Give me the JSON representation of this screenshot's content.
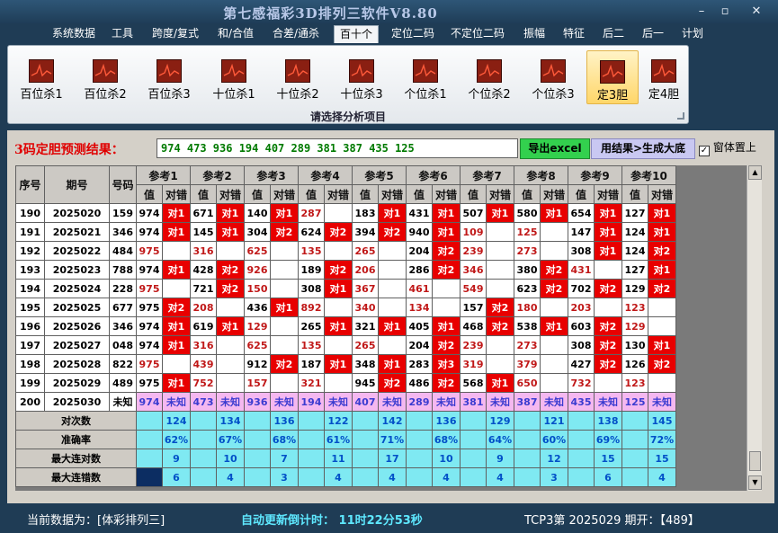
{
  "app": {
    "title": "第七感福彩3D排列三软件V8.80"
  },
  "window_controls": {
    "minimize": "–",
    "maximize": "▫",
    "close": "✕"
  },
  "menu": [
    {
      "label": "系统数据"
    },
    {
      "label": "工具"
    },
    {
      "label": "跨度/复式"
    },
    {
      "label": "和/合值"
    },
    {
      "label": "合差/通杀"
    },
    {
      "label": "百十个",
      "active": true
    },
    {
      "label": "定位二码"
    },
    {
      "label": "不定位二码"
    },
    {
      "label": "振幅"
    },
    {
      "label": "特征"
    },
    {
      "label": "后二"
    },
    {
      "label": "后一"
    },
    {
      "label": "计划"
    }
  ],
  "ribbon": {
    "buttons": [
      {
        "label": "百位杀1"
      },
      {
        "label": "百位杀2"
      },
      {
        "label": "百位杀3"
      },
      {
        "label": "十位杀1"
      },
      {
        "label": "十位杀2"
      },
      {
        "label": "十位杀3"
      },
      {
        "label": "个位杀1"
      },
      {
        "label": "个位杀2"
      },
      {
        "label": "个位杀3"
      },
      {
        "label": "定3胆",
        "active": true
      },
      {
        "label": "定4胆"
      }
    ],
    "caption": "请选择分析项目"
  },
  "prediction": {
    "label": "3码定胆预测结果：",
    "value": "974 473 936 194 407 289 381 387 435 125"
  },
  "buttons": {
    "export": "导出excel",
    "generate": "用结果>生成大底"
  },
  "ontop": {
    "label": "窗体置上",
    "checked": "✓"
  },
  "table": {
    "headers": {
      "seq": "序号",
      "period": "期号",
      "number": "号码",
      "refs": [
        "参考1",
        "参考2",
        "参考3",
        "参考4",
        "参考5",
        "参考6",
        "参考7",
        "参考8",
        "参考9",
        "参考10"
      ],
      "value": "值",
      "result": "对错"
    },
    "rows": [
      {
        "seq": "190",
        "period": "2025020",
        "num": "159",
        "cells": [
          [
            "974",
            "对1",
            1
          ],
          [
            "671",
            "对1",
            1
          ],
          [
            "140",
            "对1",
            1
          ],
          [
            "287",
            "",
            0
          ],
          [
            "183",
            "对1",
            1
          ],
          [
            "431",
            "对1",
            1
          ],
          [
            "507",
            "对1",
            1
          ],
          [
            "580",
            "对1",
            1
          ],
          [
            "654",
            "对1",
            1
          ],
          [
            "127",
            "对1",
            1
          ]
        ]
      },
      {
        "seq": "191",
        "period": "2025021",
        "num": "346",
        "cells": [
          [
            "974",
            "对1",
            1
          ],
          [
            "145",
            "对1",
            1
          ],
          [
            "304",
            "对2",
            1
          ],
          [
            "624",
            "对2",
            1
          ],
          [
            "394",
            "对2",
            1
          ],
          [
            "940",
            "对1",
            1
          ],
          [
            "109",
            "",
            0
          ],
          [
            "125",
            "",
            0
          ],
          [
            "147",
            "对1",
            1
          ],
          [
            "124",
            "对1",
            1
          ]
        ]
      },
      {
        "seq": "192",
        "period": "2025022",
        "num": "484",
        "cells": [
          [
            "975",
            "",
            0
          ],
          [
            "316",
            "",
            0
          ],
          [
            "625",
            "",
            0
          ],
          [
            "135",
            "",
            0
          ],
          [
            "265",
            "",
            0
          ],
          [
            "204",
            "对2",
            1
          ],
          [
            "239",
            "",
            0
          ],
          [
            "273",
            "",
            0
          ],
          [
            "308",
            "对1",
            1
          ],
          [
            "124",
            "对2",
            1
          ]
        ]
      },
      {
        "seq": "193",
        "period": "2025023",
        "num": "788",
        "cells": [
          [
            "974",
            "对1",
            1
          ],
          [
            "428",
            "对2",
            1
          ],
          [
            "926",
            "",
            0
          ],
          [
            "189",
            "对2",
            1
          ],
          [
            "206",
            "",
            0
          ],
          [
            "286",
            "对2",
            1
          ],
          [
            "346",
            "",
            0
          ],
          [
            "380",
            "对2",
            1
          ],
          [
            "431",
            "",
            0
          ],
          [
            "127",
            "对1",
            1
          ]
        ]
      },
      {
        "seq": "194",
        "period": "2025024",
        "num": "228",
        "cells": [
          [
            "975",
            "",
            0
          ],
          [
            "721",
            "对2",
            1
          ],
          [
            "150",
            "",
            0
          ],
          [
            "308",
            "对1",
            1
          ],
          [
            "367",
            "",
            0
          ],
          [
            "461",
            "",
            0
          ],
          [
            "549",
            "",
            0
          ],
          [
            "623",
            "对2",
            1
          ],
          [
            "702",
            "对2",
            1
          ],
          [
            "129",
            "对2",
            1
          ]
        ]
      },
      {
        "seq": "195",
        "period": "2025025",
        "num": "677",
        "cells": [
          [
            "975",
            "对2",
            1
          ],
          [
            "208",
            "",
            0
          ],
          [
            "436",
            "对1",
            1
          ],
          [
            "892",
            "",
            0
          ],
          [
            "340",
            "",
            0
          ],
          [
            "134",
            "",
            0
          ],
          [
            "157",
            "对2",
            1
          ],
          [
            "180",
            "",
            0
          ],
          [
            "203",
            "",
            0
          ],
          [
            "123",
            "",
            0
          ]
        ]
      },
      {
        "seq": "196",
        "period": "2025026",
        "num": "346",
        "cells": [
          [
            "974",
            "对1",
            1
          ],
          [
            "619",
            "对1",
            1
          ],
          [
            "129",
            "",
            0
          ],
          [
            "265",
            "对1",
            1
          ],
          [
            "321",
            "对1",
            1
          ],
          [
            "405",
            "对1",
            1
          ],
          [
            "468",
            "对2",
            1
          ],
          [
            "538",
            "对1",
            1
          ],
          [
            "603",
            "对2",
            1
          ],
          [
            "129",
            "",
            0
          ]
        ]
      },
      {
        "seq": "197",
        "period": "2025027",
        "num": "048",
        "cells": [
          [
            "974",
            "对1",
            1
          ],
          [
            "316",
            "",
            0
          ],
          [
            "625",
            "",
            0
          ],
          [
            "135",
            "",
            0
          ],
          [
            "265",
            "",
            0
          ],
          [
            "204",
            "对2",
            1
          ],
          [
            "239",
            "",
            0
          ],
          [
            "273",
            "",
            0
          ],
          [
            "308",
            "对2",
            1
          ],
          [
            "130",
            "对1",
            1
          ]
        ]
      },
      {
        "seq": "198",
        "period": "2025028",
        "num": "822",
        "cells": [
          [
            "975",
            "",
            0
          ],
          [
            "439",
            "",
            0
          ],
          [
            "912",
            "对2",
            1
          ],
          [
            "187",
            "对1",
            1
          ],
          [
            "348",
            "对1",
            1
          ],
          [
            "283",
            "对3",
            1
          ],
          [
            "319",
            "",
            0
          ],
          [
            "379",
            "",
            0
          ],
          [
            "427",
            "对2",
            1
          ],
          [
            "126",
            "对2",
            1
          ]
        ]
      },
      {
        "seq": "199",
        "period": "2025029",
        "num": "489",
        "cells": [
          [
            "975",
            "对1",
            1
          ],
          [
            "752",
            "",
            0
          ],
          [
            "157",
            "",
            0
          ],
          [
            "321",
            "",
            0
          ],
          [
            "945",
            "对2",
            1
          ],
          [
            "486",
            "对2",
            1
          ],
          [
            "568",
            "对1",
            1
          ],
          [
            "650",
            "",
            0
          ],
          [
            "732",
            "",
            0
          ],
          [
            "123",
            "",
            0
          ]
        ]
      }
    ],
    "future": {
      "seq": "200",
      "period": "2025030",
      "num": "未知",
      "cells": [
        [
          "974",
          "未知"
        ],
        [
          "473",
          "未知"
        ],
        [
          "936",
          "未知"
        ],
        [
          "194",
          "未知"
        ],
        [
          "407",
          "未知"
        ],
        [
          "289",
          "未知"
        ],
        [
          "381",
          "未知"
        ],
        [
          "387",
          "未知"
        ],
        [
          "435",
          "未知"
        ],
        [
          "125",
          "未知"
        ]
      ]
    },
    "stats": [
      {
        "label": "对次数",
        "values": [
          "124",
          "134",
          "136",
          "122",
          "142",
          "136",
          "129",
          "121",
          "138",
          "145"
        ]
      },
      {
        "label": "准确率",
        "values": [
          "62%",
          "67%",
          "68%",
          "61%",
          "71%",
          "68%",
          "64%",
          "60%",
          "69%",
          "72%"
        ]
      },
      {
        "label": "最大连对数",
        "values": [
          "9",
          "10",
          "7",
          "11",
          "17",
          "10",
          "9",
          "12",
          "15",
          "15"
        ]
      },
      {
        "label": "最大连错数",
        "values": [
          "6",
          "4",
          "3",
          "4",
          "4",
          "4",
          "4",
          "3",
          "6",
          "4"
        ]
      }
    ]
  },
  "status": {
    "current": "当前数据为：[体彩排列三]",
    "countdown": "自动更新倒计时：  11时22分53秒",
    "period": "TCP3第 2025029 期开：【489】"
  }
}
